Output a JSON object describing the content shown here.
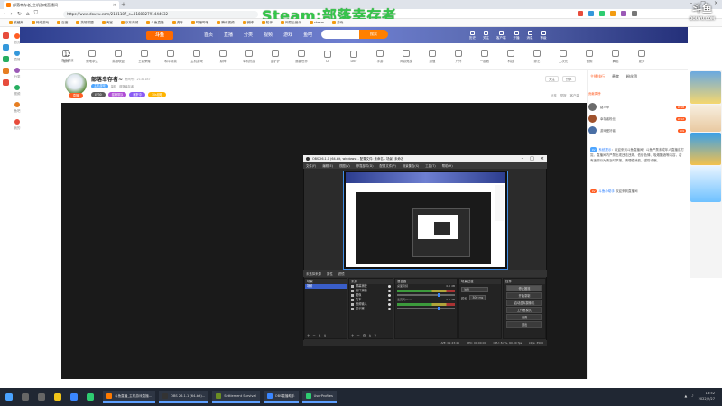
{
  "browser": {
    "tab_title": "部落幸存者_主机游戏直播间",
    "url": "https://www.douyu.com/2131187_s=318882791444632",
    "overlay_text": "Steam:部落幸存者",
    "bookmarks": [
      "收藏夹",
      "网络游戏",
      "百度",
      "英雄联盟",
      "淘宝",
      "京东商城",
      "斗鱼直播",
      "虎牙",
      "哔哩哔哩",
      "腾讯视频",
      "微博",
      "知乎",
      "网易云音乐",
      "steam",
      "游戏"
    ],
    "brand_overlay": "斗鱼",
    "brand_sub": "DOUYU.COM"
  },
  "left_rail": [
    "首页",
    "直播",
    "分类",
    "视频",
    "鱼吧",
    "我的"
  ],
  "header": {
    "logo": "斗鱼",
    "nav": [
      "首页",
      "直播",
      "分类",
      "视频",
      "游戏",
      "鱼吧",
      "赛事"
    ],
    "search_button": "搜索",
    "icons": [
      "历史",
      "关注",
      "客户端",
      "开播",
      "消息",
      "等级"
    ]
  },
  "categories": {
    "first_value": "12",
    "first_label": "直播频道",
    "items": [
      "推荐",
      "绝地求生",
      "英雄联盟",
      "王者荣耀",
      "和平精英",
      "主机游戏",
      "原神",
      "单机热游",
      "金铲铲",
      "魔兽世界",
      "CF",
      "DNF",
      "手游",
      "网游竞技",
      "颜值",
      "户外",
      "一起看",
      "科技",
      "综艺",
      "二次元",
      "音频",
      "舞蹈",
      "更多"
    ]
  },
  "streamer": {
    "name": "部落幸存者~",
    "sub": "房间号：2131187",
    "meta": [
      "主机游戏",
      "单机",
      "部落幸存者"
    ],
    "tags": [
      "LV30",
      "猫粮带队",
      "爆肝中",
      "30s领取"
    ],
    "right_buttons": [
      "关注",
      "分享"
    ],
    "share_row": [
      "分享",
      "举报",
      "客户端"
    ]
  },
  "obs": {
    "title": "OBS 26.1.1 (64-bit, windows) - 配置文件: 未命名 - 场景: 未命名",
    "menu": [
      "文件(F)",
      "编辑(E)",
      "视图(V)",
      "停靠部件(D)",
      "配置文件(P)",
      "场景集合(S)",
      "工具(T)",
      "帮助(H)"
    ],
    "toolbar": [
      "属性",
      "滤镜"
    ],
    "scenes_header": "场景",
    "scenes": [
      "场景"
    ],
    "sources_header": "来源",
    "sources": [
      "屏幕捕获",
      "窗口捕获",
      "图像",
      "文本",
      "音频输入",
      "显示器"
    ],
    "mixer_header": "混音器",
    "mixer": [
      {
        "name": "桌面音频",
        "db": "0.0 dB"
      },
      {
        "name": "麦克风/Aux",
        "db": "0.0 dB"
      }
    ],
    "transitions_header": "场景过渡",
    "transition": "淡出",
    "duration_label": "时长",
    "duration": "300 ms",
    "controls_header": "控件",
    "controls": [
      "停止推流",
      "开始录制",
      "启动虚拟摄像机",
      "工作室模式",
      "设置",
      "退出"
    ],
    "status": [
      "LIVE: 01:23:45",
      "REC: 00:00:00",
      "CPU: 8.0%, 60.00 fps",
      "kb/s: 3500"
    ]
  },
  "chat": {
    "tabs": [
      "主播排行",
      "贵宾",
      "粉丝团"
    ],
    "sub_tab": "贡献周榜",
    "ranks": [
      {
        "name": "路人甲",
        "tag": "LV18"
      },
      {
        "name": "幸存者粉丝",
        "tag": "LV12"
      },
      {
        "name": "游戏爱好者",
        "tag": "LV9"
      }
    ],
    "msg_user": "系统提示",
    "message": "欢迎来到斗鱼直播间！斗鱼严禁未成年人直播或打赏。直播间内严禁出现违法违规、低俗色情、吸烟酗酒等内容，若有违规行为请及时举报。请理性消费，谨防诈骗。",
    "msg2_user": "斗鱼小助手",
    "message2": "欢迎来到直播间"
  },
  "taskbar": {
    "apps": [
      "斗鱼直播_主机游戏直播...",
      "OBS 26.1.1 (64-bit)...",
      "Settlement Survival",
      "OBS直播助手",
      "UserProfiles"
    ],
    "time": "13:52",
    "date": "2022/2/27"
  }
}
